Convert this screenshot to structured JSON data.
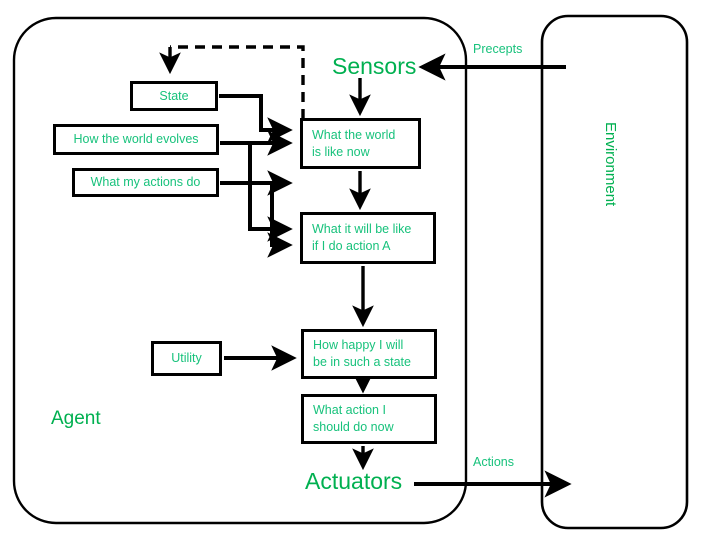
{
  "diagram": {
    "type": "utility-based-agent",
    "accent_green": "#00b050",
    "node_green": "#18c27c",
    "line_black": "#000000",
    "containers": {
      "agent": {
        "label": "Agent"
      },
      "environment": {
        "label": "Environment"
      }
    },
    "interfaces": {
      "sensors": "Sensors",
      "actuators": "Actuators"
    },
    "edge_labels": {
      "percepts": "Precepts",
      "actions": "Actions"
    },
    "nodes": {
      "state": {
        "lines": [
          "State"
        ]
      },
      "evolves": {
        "lines": [
          "How the world evolves"
        ]
      },
      "actions_do": {
        "lines": [
          "What my actions do"
        ]
      },
      "world_now": {
        "lines": [
          "What the world",
          "is like now"
        ]
      },
      "will_be": {
        "lines": [
          "What it will be like",
          "if I do action A"
        ]
      },
      "utility": {
        "lines": [
          "Utility"
        ]
      },
      "happy": {
        "lines": [
          "How happy I will",
          "be in such a state"
        ]
      },
      "what_action": {
        "lines": [
          "What action I",
          "should do now"
        ]
      }
    }
  }
}
